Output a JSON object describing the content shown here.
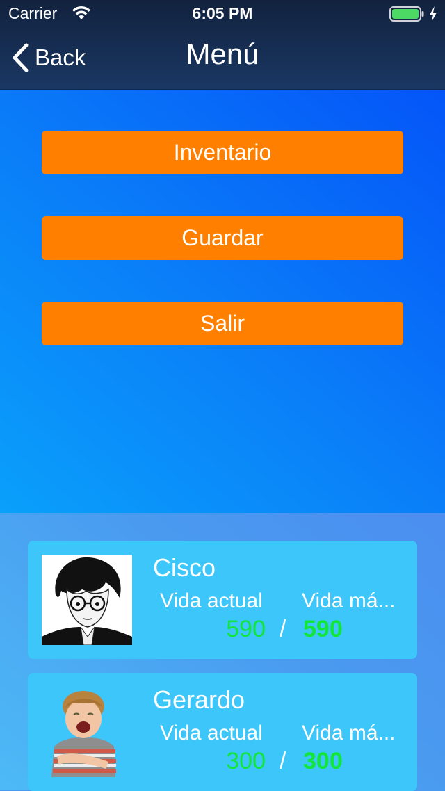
{
  "status_bar": {
    "carrier": "Carrier",
    "time": "6:05 PM"
  },
  "nav": {
    "back_label": "Back",
    "title": "Menú"
  },
  "menu": {
    "buttons": [
      {
        "label": "Inventario"
      },
      {
        "label": "Guardar"
      },
      {
        "label": "Salir"
      }
    ]
  },
  "party": {
    "current_hp_label": "Vida actual",
    "max_hp_label": "Vida má...",
    "separator": "/",
    "characters": [
      {
        "name": "Cisco",
        "hp_current": "590",
        "hp_max": "590"
      },
      {
        "name": "Gerardo",
        "hp_current": "300",
        "hp_max": "300"
      }
    ]
  },
  "colors": {
    "accent_orange": "#ff8000",
    "hp_green": "#12e63c",
    "battery_green": "#4cd964"
  }
}
